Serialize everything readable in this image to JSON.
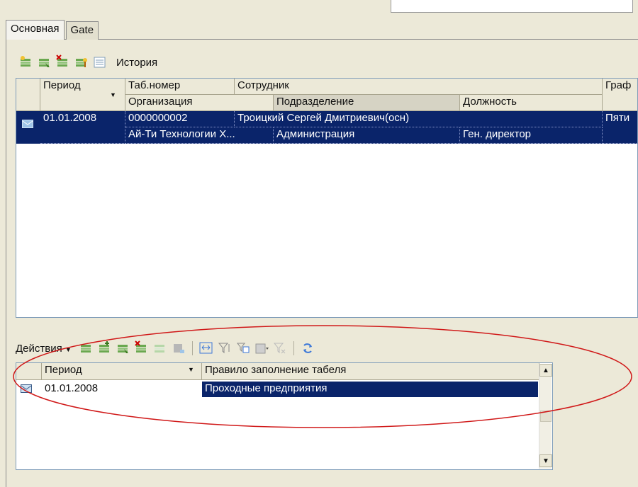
{
  "tabs": [
    "Основная",
    "Gate"
  ],
  "toolbar1": {
    "icons": [
      "add-row-icon",
      "copy-row-icon",
      "delete-row-icon",
      "edit-row-icon",
      "list-icon"
    ],
    "history_label": "История"
  },
  "grid1": {
    "header_row1": [
      "Период",
      "Таб.номер",
      "Сотрудник",
      "Граф"
    ],
    "header_row2": [
      "Организация",
      "Подразделение",
      "Должность"
    ],
    "row": {
      "period": "01.01.2008",
      "tab_number": "0000000002",
      "employee": "Троицкий Сергей Дмитриевич(осн)",
      "schedule": "Пяти",
      "organization": "Ай-Ти Технологии Х...",
      "department": "Администрация",
      "position": "Ген. директор"
    }
  },
  "toolbar2": {
    "actions_label": "Действия",
    "icons": [
      "add-icon",
      "add-group-icon",
      "copy-icon",
      "delete-icon",
      "edit-icon",
      "mark-icon",
      "resize-columns-icon",
      "filter-icon",
      "filter-by-value-icon",
      "filter-dropdown-icon",
      "clear-filter-icon",
      "refresh-icon"
    ]
  },
  "grid2": {
    "headers": [
      "Период",
      "Правило заполнение табеля"
    ],
    "row": {
      "period": "01.01.2008",
      "rule": "Проходные предприятия"
    }
  },
  "colors": {
    "selection": "#0a246a",
    "annotation": "#d01818",
    "window_bg": "#ece9d8"
  }
}
